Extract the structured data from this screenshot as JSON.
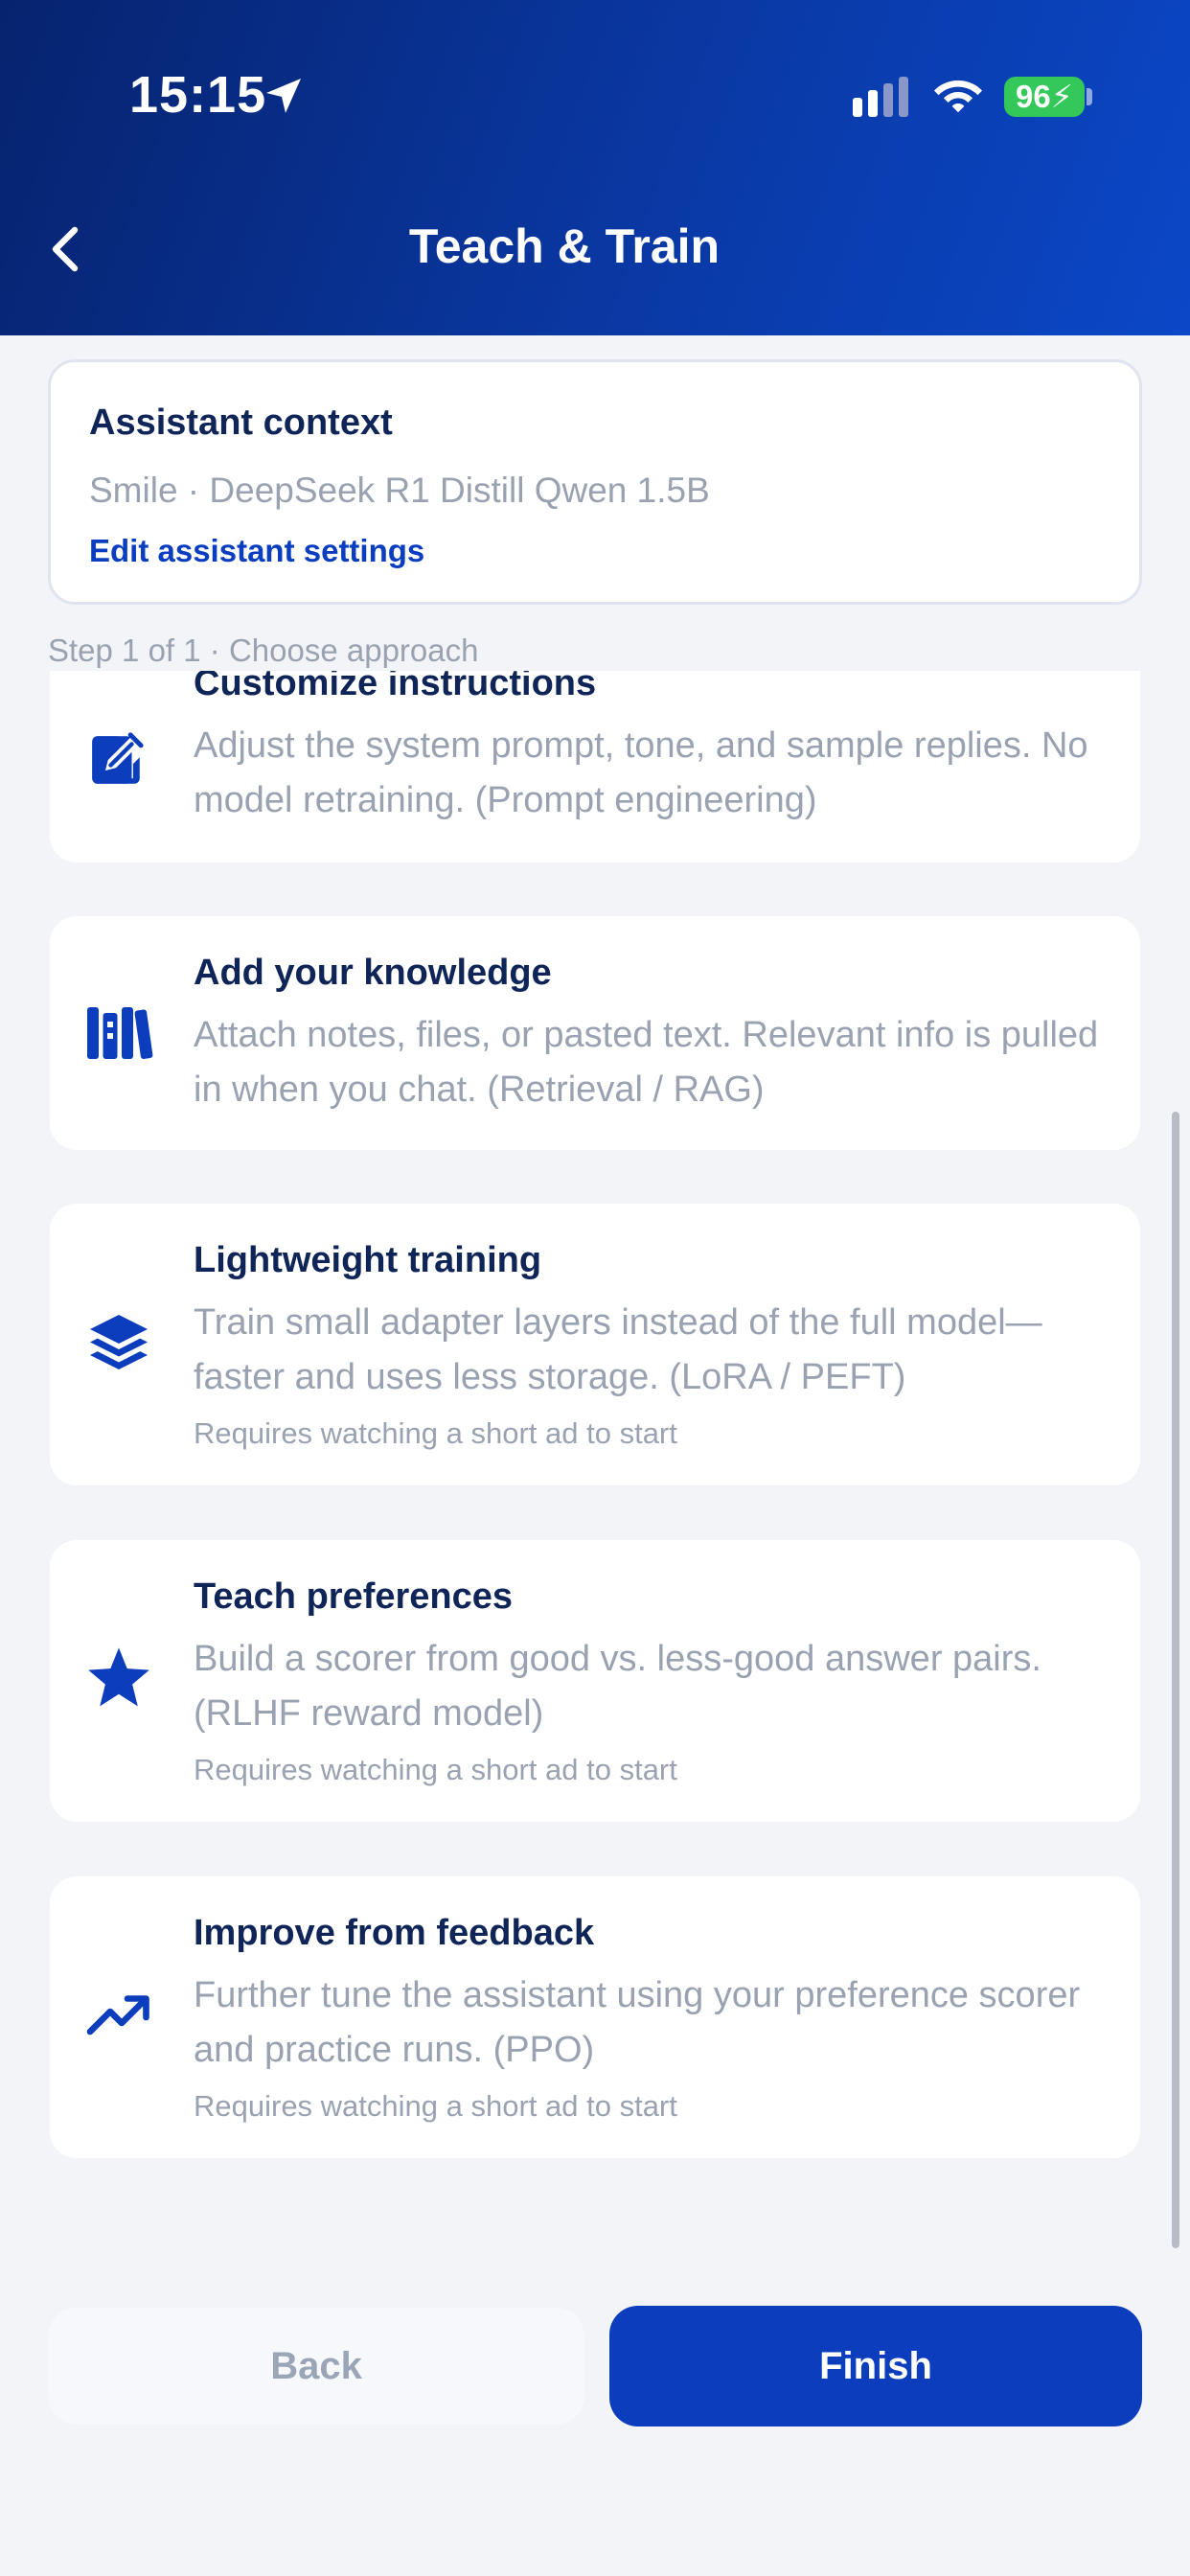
{
  "status_bar": {
    "time": "15:15",
    "battery": "96",
    "icons": [
      "location-arrow-icon",
      "cellular-signal-icon",
      "wifi-icon",
      "battery-charging-icon"
    ]
  },
  "header": {
    "title": "Teach & Train",
    "back_icon": "chevron-left-icon"
  },
  "context": {
    "title": "Assistant context",
    "subtitle": "Smile · DeepSeek R1 Distill Qwen 1.5B",
    "edit_link": "Edit assistant settings"
  },
  "step_label": "Step 1 of 1 · Choose approach",
  "options": [
    {
      "icon": "edit-square-icon",
      "title": "Customize instructions",
      "desc": "Adjust the system prompt, tone, and sample replies. No model retraining. (Prompt engineering)",
      "note": ""
    },
    {
      "icon": "library-books-icon",
      "title": "Add your knowledge",
      "desc": "Attach notes, files, or pasted text. Relevant info is pulled in when you chat. (Retrieval / RAG)",
      "note": ""
    },
    {
      "icon": "layers-icon",
      "title": "Lightweight training",
      "desc": "Train small adapter layers instead of the full model—faster and uses less storage. (LoRA / PEFT)",
      "note": "Requires watching a short ad to start"
    },
    {
      "icon": "star-icon",
      "title": "Teach preferences",
      "desc": "Build a scorer from good vs. less-good answer pairs. (RLHF reward model)",
      "note": "Requires watching a short ad to start"
    },
    {
      "icon": "trending-up-icon",
      "title": "Improve from feedback",
      "desc": "Further tune the assistant using your preference scorer and practice runs. (PPO)",
      "note": "Requires watching a short ad to start"
    }
  ],
  "buttons": {
    "back": "Back",
    "finish": "Finish"
  },
  "colors": {
    "accent": "#0b3dbd",
    "header_dark": "#06236e",
    "muted_text": "#9aa2b1",
    "title_text": "#0f2557",
    "battery_green": "#34c759"
  }
}
